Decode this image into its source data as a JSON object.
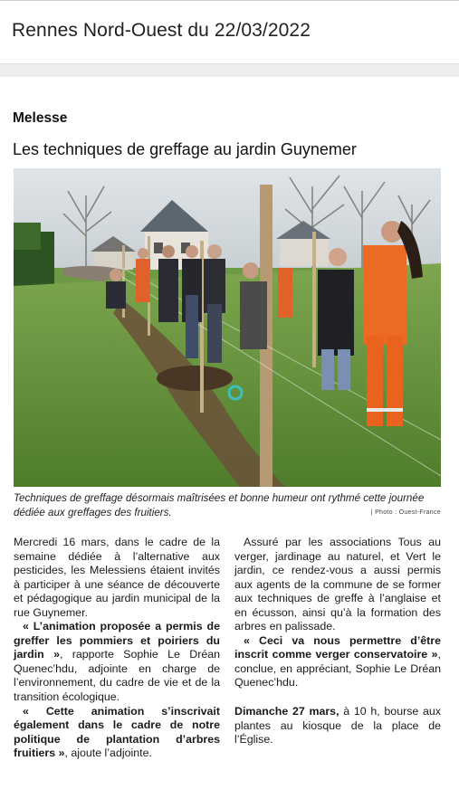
{
  "edition": "Rennes Nord-Ouest du 22/03/2022",
  "article": {
    "town": "Melesse",
    "headline": "Les techniques de greffage au jardin Guynemer",
    "caption": "Techniques de greffage désormais maîtrisées et bonne humeur ont rythmé cette journée dédiée aux greffages des fruitiers.",
    "credit": "| Photo : Ouest-France",
    "col1": {
      "p1": "Mercredi 16 mars, dans le cadre de la semaine dédiée à l’alternative aux pesticides, les Melessiens étaient invités à participer à une séance de découverte et pédagogique au jardin municipal de la rue Guynemer.",
      "p2_bold": "« L’animation proposée a permis de greffer les pommiers et poiriers du jardin »",
      "p2_rest": ", rapporte Sophie Le Dréan Quenec’hdu, adjointe en charge de l’environnement, du cadre de vie et de la transition écologique.",
      "p3_bold": "« Cette animation s’inscrivait également dans le cadre de notre politique de plantation d’arbres fruitiers »",
      "p3_rest": ", ajoute l’adjointe."
    },
    "col2": {
      "p1": "Assuré par les associations Tous au verger, jardinage au naturel, et Vert le jardin, ce rendez-vous a aussi permis aux agents de la commune de se former aux techniques de greffe à l’anglaise et en écusson, ainsi qu’à la formation des arbres en palissade.",
      "p2_bold": "« Ceci va nous permettre d’être inscrit comme verger conservatoire »",
      "p2_rest": ", conclue, en appréciant, Sophie Le Dréan Quenec’hdu.",
      "p3_bold": "Dimanche 27 mars,",
      "p3_rest": " à 10 h, bourse aux plantes au kiosque de la place de l’Église."
    }
  }
}
